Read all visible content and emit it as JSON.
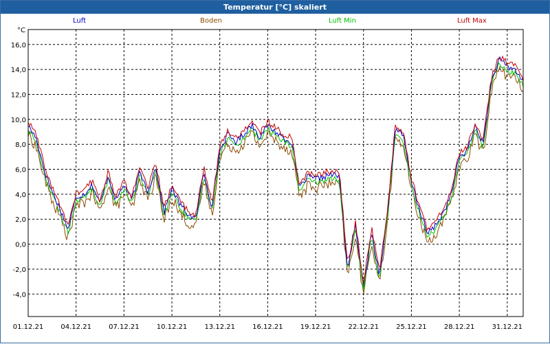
{
  "window": {
    "title": "Temperatur [°C] skaliert"
  },
  "chart_data": {
    "type": "line",
    "title": "Temperatur [°C] skaliert",
    "ylabel": "°C",
    "ylim": [
      -5.8,
      17.2
    ],
    "grid": true,
    "x_range": [
      "2021-12-01",
      "2022-01-01"
    ],
    "x_tick_labels": [
      "01.12.21",
      "04.12.21",
      "07.12.21",
      "10.12.21",
      "13.12.21",
      "16.12.21",
      "19.12.21",
      "22.12.21",
      "25.12.21",
      "28.12.21",
      "31.12.21"
    ],
    "y_ticks": [
      -4,
      -2,
      0,
      2,
      4,
      6,
      8,
      10,
      12,
      14,
      16
    ],
    "y_tick_labels": [
      "-4,0",
      "-2,0",
      "0,0",
      "2,0",
      "4,0",
      "6,0",
      "8,0",
      "10,0",
      "12,0",
      "14,0",
      "16,0"
    ],
    "base_x": [
      "2021-12-01",
      "2021-12-01 12:00",
      "2021-12-02",
      "2021-12-02 12:00",
      "2021-12-03",
      "2021-12-03 12:00",
      "2021-12-04",
      "2021-12-04 12:00",
      "2021-12-05",
      "2021-12-05 12:00",
      "2021-12-06",
      "2021-12-06 12:00",
      "2021-12-07",
      "2021-12-07 12:00",
      "2021-12-08",
      "2021-12-08 12:00",
      "2021-12-09",
      "2021-12-09 12:00",
      "2021-12-10",
      "2021-12-10 12:00",
      "2021-12-11",
      "2021-12-11 12:00",
      "2021-12-12",
      "2021-12-12 12:00",
      "2021-12-13",
      "2021-12-13 12:00",
      "2021-12-14",
      "2021-12-14 12:00",
      "2021-12-15",
      "2021-12-15 12:00",
      "2021-12-16",
      "2021-12-16 12:00",
      "2021-12-17",
      "2021-12-17 12:00",
      "2021-12-18",
      "2021-12-18 12:00",
      "2021-12-19",
      "2021-12-19 12:00",
      "2021-12-20",
      "2021-12-20 12:00",
      "2021-12-21",
      "2021-12-21 12:00",
      "2021-12-22",
      "2021-12-22 12:00",
      "2021-12-23",
      "2021-12-23 12:00",
      "2021-12-24",
      "2021-12-24 12:00",
      "2021-12-25",
      "2021-12-25 12:00",
      "2021-12-26",
      "2021-12-26 12:00",
      "2021-12-27",
      "2021-12-27 12:00",
      "2021-12-28",
      "2021-12-28 12:00",
      "2021-12-29",
      "2021-12-29 12:00",
      "2021-12-30",
      "2021-12-30 12:00",
      "2021-12-31",
      "2021-12-31 12:00",
      "2022-01-01"
    ],
    "base_y": [
      9.5,
      8.5,
      6.0,
      4.2,
      2.8,
      1.2,
      3.8,
      4.0,
      4.8,
      3.2,
      5.5,
      3.5,
      4.8,
      3.5,
      5.8,
      4.2,
      6.2,
      2.5,
      4.5,
      3.2,
      2.4,
      2.0,
      5.8,
      3.0,
      7.5,
      8.8,
      8.2,
      8.8,
      9.6,
      8.6,
      9.5,
      9.0,
      8.5,
      8.2,
      4.5,
      5.4,
      5.2,
      5.4,
      5.6,
      5.4,
      -2.0,
      1.5,
      -3.5,
      1.0,
      -2.5,
      2.5,
      9.3,
      8.6,
      5.0,
      2.8,
      0.8,
      1.5,
      2.5,
      4.0,
      7.0,
      7.5,
      9.5,
      8.0,
      13.0,
      14.8,
      14.2,
      14.0,
      13.0
    ],
    "series": [
      {
        "name": "Luft",
        "color": "#0000c8",
        "offset": 0.0,
        "noise": 0.25
      },
      {
        "name": "Boden",
        "color": "#8b4a00",
        "offset": -0.7,
        "noise": 0.45
      },
      {
        "name": "Luft Min",
        "color": "#00c000",
        "offset": -0.3,
        "noise": 0.25
      },
      {
        "name": "Luft Max",
        "color": "#c00000",
        "offset": 0.3,
        "noise": 0.25
      }
    ]
  }
}
